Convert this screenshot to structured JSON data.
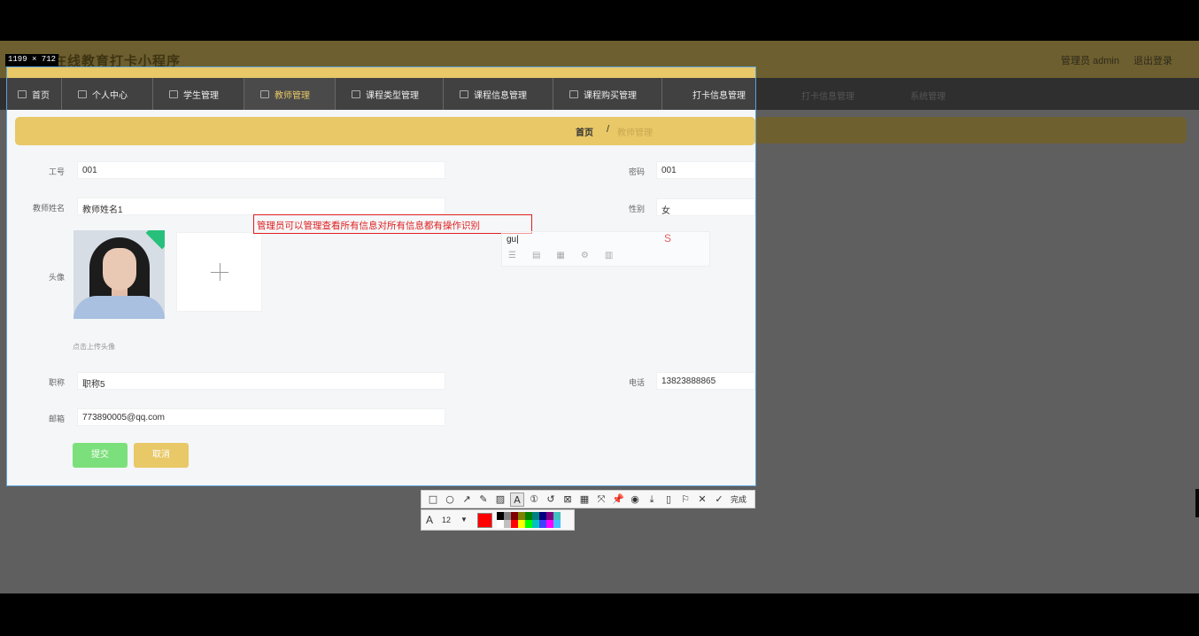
{
  "app": {
    "title": "在线教育打卡小程序",
    "user_links": [
      "管理员 admin",
      "退出登录"
    ],
    "dim_nav": [
      "打卡信息管理",
      "系统管理"
    ]
  },
  "size_tag": "1199 × 712",
  "nav": [
    {
      "label": "首页",
      "icon": "home-icon",
      "active": false
    },
    {
      "label": "个人中心",
      "icon": "user-icon",
      "active": false
    },
    {
      "label": "学生管理",
      "icon": "grid-icon",
      "active": false
    },
    {
      "label": "教师管理",
      "icon": "grid-icon",
      "active": true
    },
    {
      "label": "课程类型管理",
      "icon": "grid-icon",
      "active": false
    },
    {
      "label": "课程信息管理",
      "icon": "grid-icon",
      "active": false
    },
    {
      "label": "课程购买管理",
      "icon": "grid-icon",
      "active": false
    },
    {
      "label": "打卡信息管理",
      "icon": "grid-icon",
      "active": false
    }
  ],
  "breadcrumb": {
    "home": "首页",
    "sep": "/",
    "current": "教师管理"
  },
  "form": {
    "gonghao_label": "工号",
    "gonghao_value": "001",
    "mima_label": "密码",
    "mima_value": "001",
    "name_label": "教师姓名",
    "name_value": "教师姓名1",
    "sex_label": "性别",
    "sex_value": "女",
    "avatar_label": "头像",
    "avatar_hint": "点击上传头像",
    "title_label": "职称",
    "title_value": "职称5",
    "phone_label": "电话",
    "phone_value": "13823888865",
    "email_label": "邮箱",
    "email_value": "773890005@qq.com",
    "submit": "提交",
    "cancel": "取消"
  },
  "annotation": {
    "text": "管理员可以管理查看所有信息对所有信息都有操作识别",
    "ime_input": "gu|",
    "ime_tools": [
      "☰",
      "▤",
      "▦",
      "⚙",
      "▥"
    ],
    "ime_logo": "S"
  },
  "toolbar": {
    "tools": [
      "□",
      "○",
      "↗",
      "✎",
      "▨",
      "A",
      "①",
      "↺",
      "⊠",
      "▦",
      "⤧",
      "📌",
      "◉",
      "⤓",
      "▯",
      "⚐",
      "✕",
      "✓"
    ],
    "done_label": "完成"
  },
  "toolbar2": {
    "font_size": "12",
    "current_color": "#ff0000",
    "palette": [
      "#000000",
      "#808080",
      "#800000",
      "#808000",
      "#008000",
      "#008080",
      "#000080",
      "#800080",
      "#40c0c0",
      "#ffffff",
      "#c0c0c0",
      "#ff0000",
      "#ffff00",
      "#00ff00",
      "#00c0c0",
      "#4040ff",
      "#ff00ff",
      "#40c0ff"
    ]
  },
  "colors": {
    "accent": "#e8c867",
    "nav_bg": "#414141",
    "submit": "#7be07b",
    "cancel": "#e8c867",
    "annotation": "#e02020"
  }
}
